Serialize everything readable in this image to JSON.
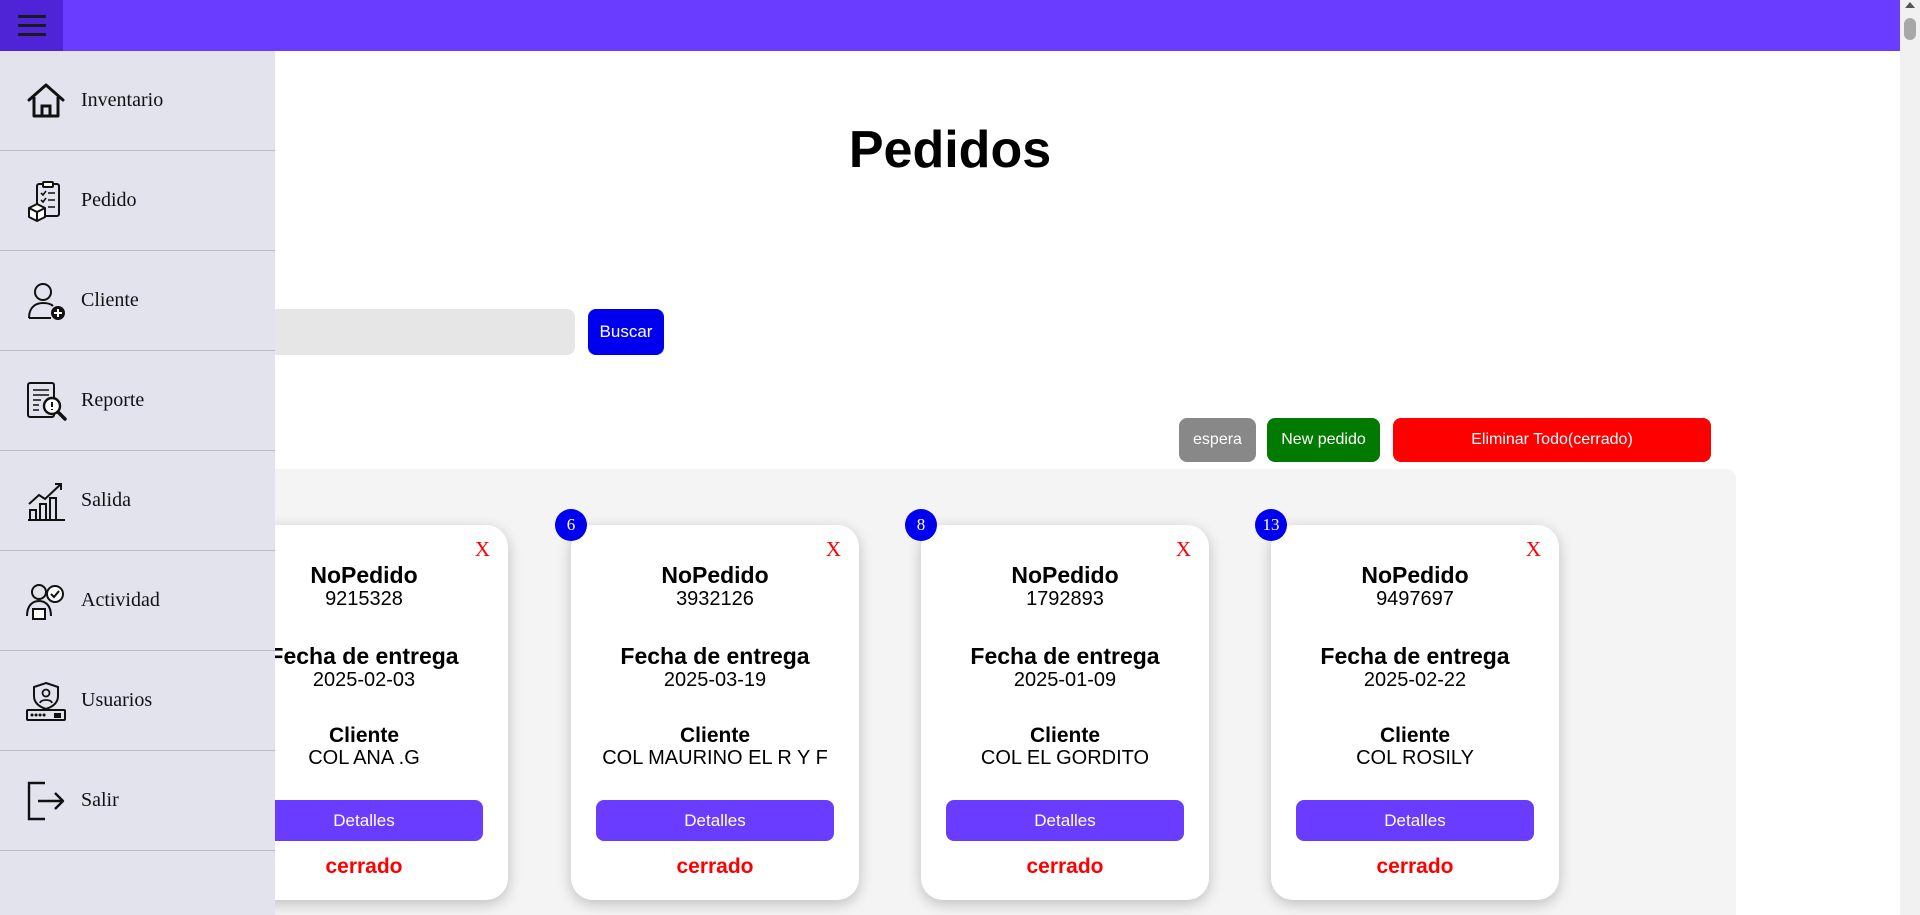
{
  "page": {
    "title": "Pedidos"
  },
  "search": {
    "placeholder": "",
    "button_label": "Buscar"
  },
  "actions": {
    "espera_label": "espera",
    "new_label": "New pedido",
    "delete_label": "Eliminar Todo(cerrado)"
  },
  "sidebar": {
    "items": [
      {
        "label": "Inventario",
        "icon": "home-icon"
      },
      {
        "label": "Pedido",
        "icon": "order-clipboard-icon"
      },
      {
        "label": "Cliente",
        "icon": "add-user-icon"
      },
      {
        "label": "Reporte",
        "icon": "report-search-icon"
      },
      {
        "label": "Salida",
        "icon": "growth-chart-icon"
      },
      {
        "label": "Actividad",
        "icon": "activity-users-icon"
      },
      {
        "label": "Usuarios",
        "icon": "user-password-icon"
      },
      {
        "label": "Salir",
        "icon": "logout-icon"
      }
    ]
  },
  "card_labels": {
    "order": "NoPedido",
    "date": "Fecha de entrega",
    "client": "Cliente",
    "details": "Detalles",
    "close": "X"
  },
  "orders": [
    {
      "badge": "",
      "number": "9215328",
      "date": "2025-02-03",
      "client": "COL ANA .G",
      "status": "cerrado"
    },
    {
      "badge": "6",
      "number": "3932126",
      "date": "2025-03-19",
      "client": "COL MAURINO EL R Y F",
      "status": "cerrado"
    },
    {
      "badge": "8",
      "number": "1792893",
      "date": "2025-01-09",
      "client": "COL EL GORDITO",
      "status": "cerrado"
    },
    {
      "badge": "13",
      "number": "9497697",
      "date": "2025-02-22",
      "client": "COL ROSILY",
      "status": "cerrado"
    }
  ],
  "colors": {
    "accent": "#6a3cff",
    "primary_button": "#0000ee",
    "danger": "#ff0000",
    "success": "#007a00",
    "neutral": "#888888"
  }
}
